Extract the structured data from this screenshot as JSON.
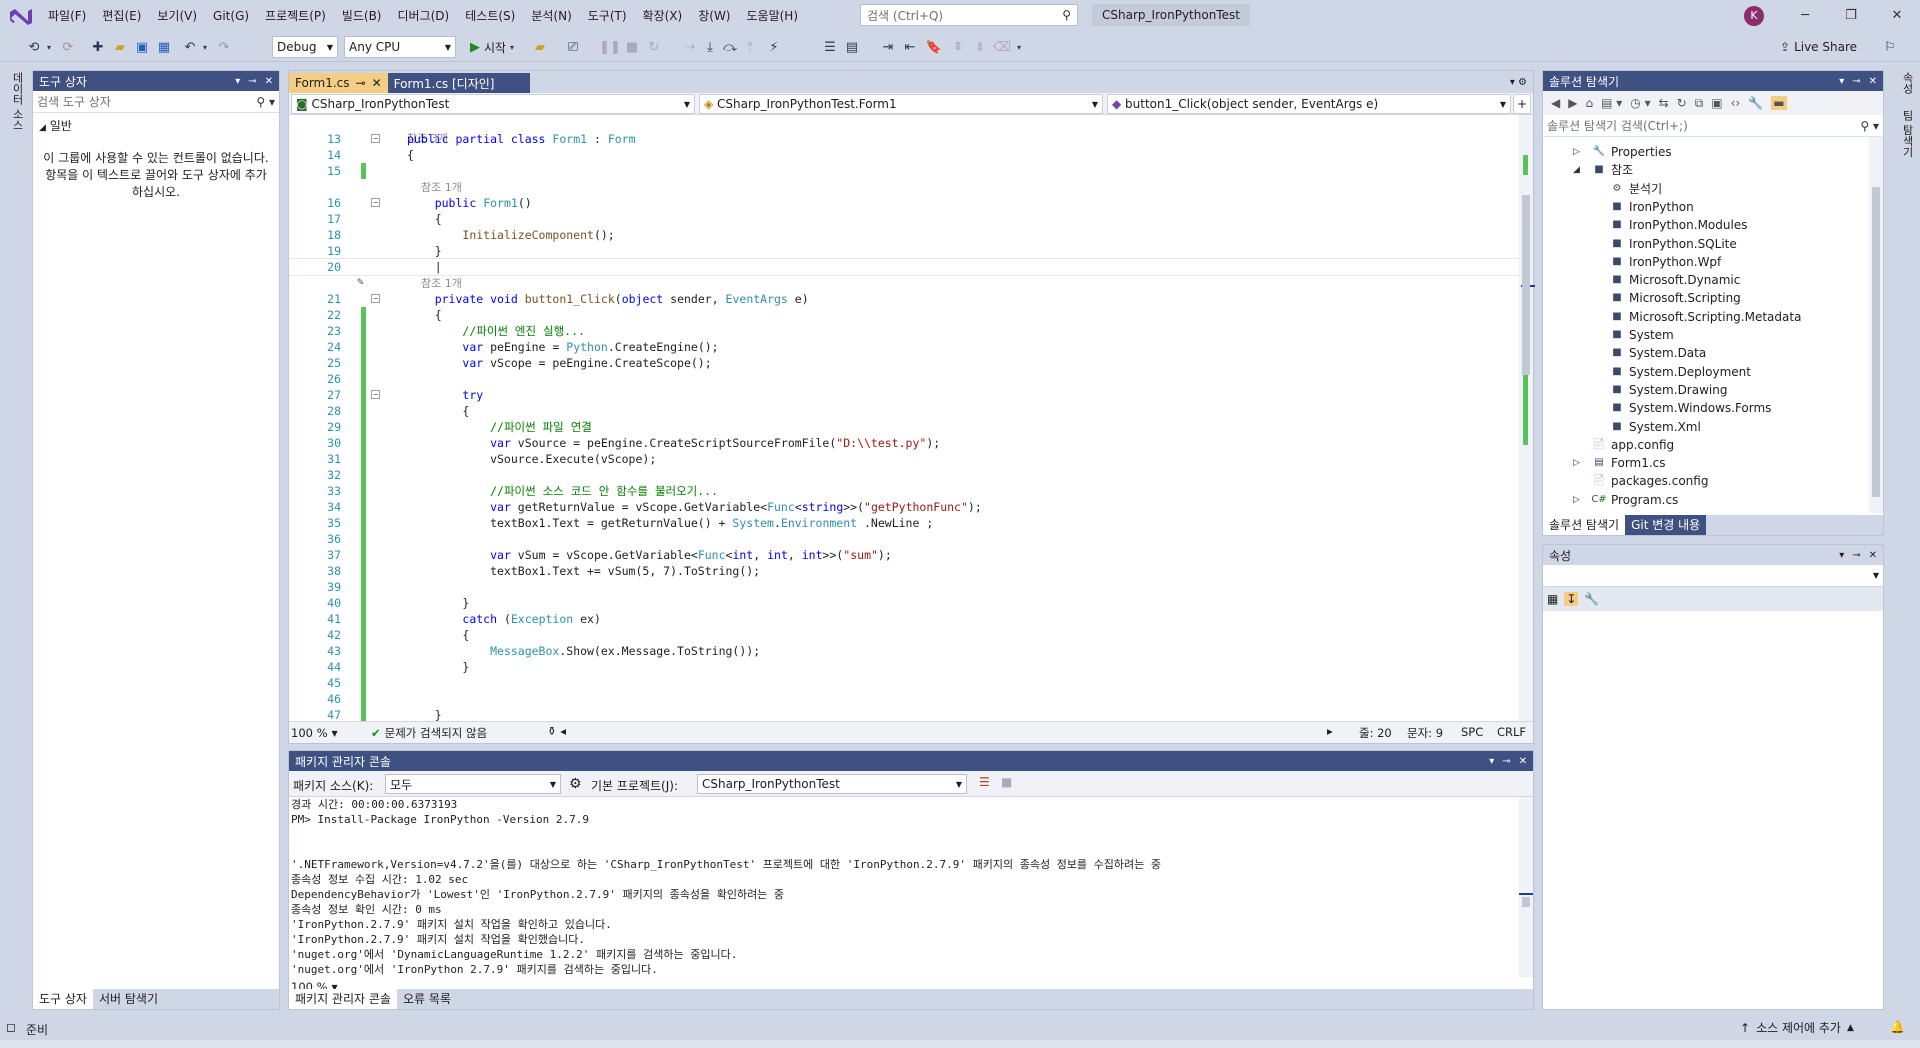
{
  "app": {
    "title": "CSharp_IronPythonTest",
    "search_placeholder": "검색 (Ctrl+Q)",
    "avatar_initial": "K",
    "accent": "#3e5182",
    "active_tab_color": "#f5cc84"
  },
  "menu": [
    "파일(F)",
    "편집(E)",
    "보기(V)",
    "Git(G)",
    "프로젝트(P)",
    "빌드(B)",
    "디버그(D)",
    "테스트(S)",
    "분석(N)",
    "도구(T)",
    "확장(X)",
    "창(W)",
    "도움말(H)"
  ],
  "toolbar": {
    "config": "Debug",
    "platform": "Any CPU",
    "start_label": "시작",
    "live_share": "Live Share"
  },
  "left_strip": {
    "tab": "데이터 소스"
  },
  "right_strip": {
    "tab1": "속성",
    "tab2": "팀 탐색기"
  },
  "toolbox": {
    "title": "도구 상자",
    "search_placeholder": "검색 도구 상자",
    "group": "일반",
    "empty_text": "이 그룹에 사용할 수 있는 컨트롤이 없습니다. 항목을 이 텍스트로 끌어와 도구 상자에 추가하십시오.",
    "tab_toolbox": "도구 상자",
    "tab_server": "서버 탐색기"
  },
  "editor": {
    "tabs": [
      {
        "label": "Form1.cs",
        "pin": "⊸",
        "close": "✕"
      },
      {
        "label": "Form1.cs [디자인]"
      }
    ],
    "nav_project": "CSharp_IronPythonTest",
    "nav_class": "CSharp_IronPythonTest.Form1",
    "nav_member": "button1_Click(object sender, EventArgs e)",
    "lens_top": "참조 3개",
    "lines": [
      {
        "n": "13",
        "html": "<span class=\"kw\">public partial class</span> <span class=\"ty\">Form1</span> : <span class=\"ty\">Form</span>"
      },
      {
        "n": "14",
        "html": "{"
      },
      {
        "n": "15",
        "html": ""
      },
      {
        "n": "",
        "html": "<span class=\"lens\">    참조 1개</span>"
      },
      {
        "n": "16",
        "html": "    <span class=\"kw\">public</span> <span class=\"ty\">Form1</span>()"
      },
      {
        "n": "17",
        "html": "    {"
      },
      {
        "n": "18",
        "html": "        <span style=\"color:#74531f\">InitializeComponent</span>();"
      },
      {
        "n": "19",
        "html": "    }"
      },
      {
        "n": "20",
        "html": "    |"
      },
      {
        "n": "",
        "html": "<span class=\"lens\">    참조 1개</span>"
      },
      {
        "n": "21",
        "html": "    <span class=\"kw\">private void</span> <span style=\"color:#74531f\">button1_Click</span>(<span class=\"kw\">object</span> sender, <span class=\"ty\">EventArgs</span> e)"
      },
      {
        "n": "22",
        "html": "    {"
      },
      {
        "n": "23",
        "html": "        <span class=\"cm\">//파이썬 엔진 실행...</span>"
      },
      {
        "n": "24",
        "html": "        <span class=\"kw\">var</span> peEngine = <span class=\"ty\">Python</span>.CreateEngine();"
      },
      {
        "n": "25",
        "html": "        <span class=\"kw\">var</span> vScope = peEngine.CreateScope();"
      },
      {
        "n": "26",
        "html": ""
      },
      {
        "n": "27",
        "html": "        <span class=\"kw\">try</span>"
      },
      {
        "n": "28",
        "html": "        {"
      },
      {
        "n": "29",
        "html": "            <span class=\"cm\">//파이썬 파일 연결</span>"
      },
      {
        "n": "30",
        "html": "            <span class=\"kw\">var</span> vSource = peEngine.CreateScriptSourceFromFile(<span class=\"st\">\"D:\\\\test.py\"</span>);"
      },
      {
        "n": "31",
        "html": "            vSource.Execute(vScope);"
      },
      {
        "n": "32",
        "html": ""
      },
      {
        "n": "33",
        "html": "            <span class=\"cm\">//파이썬 소스 코드 안 함수를 불러오기...</span>"
      },
      {
        "n": "34",
        "html": "            <span class=\"kw\">var</span> getReturnValue = vScope.GetVariable&lt;<span class=\"ty\">Func</span>&lt;<span class=\"kw\">string</span>&gt;&gt;(<span class=\"st\">\"getPythonFunc\"</span>);"
      },
      {
        "n": "35",
        "html": "            textBox1.Text = getReturnValue() + <span class=\"ty\">System</span>.<span class=\"ty\">Environment</span> .NewLine ;"
      },
      {
        "n": "36",
        "html": ""
      },
      {
        "n": "37",
        "html": "            <span class=\"kw\">var</span> vSum = vScope.GetVariable&lt;<span class=\"ty\">Func</span>&lt;<span class=\"kw\">int</span>, <span class=\"kw\">int</span>, <span class=\"kw\">int</span>&gt;&gt;(<span class=\"st\">\"sum\"</span>);"
      },
      {
        "n": "38",
        "html": "            textBox1.Text += vSum(5, 7).ToString();"
      },
      {
        "n": "39",
        "html": ""
      },
      {
        "n": "40",
        "html": "        }"
      },
      {
        "n": "41",
        "html": "        <span class=\"kw\">catch</span> (<span class=\"ty\">Exception</span> ex)"
      },
      {
        "n": "42",
        "html": "        {"
      },
      {
        "n": "43",
        "html": "            <span class=\"ty\">MessageBox</span>.Show(ex.Message.ToString());"
      },
      {
        "n": "44",
        "html": "        }"
      },
      {
        "n": "45",
        "html": ""
      },
      {
        "n": "46",
        "html": ""
      },
      {
        "n": "47",
        "html": "    }"
      }
    ],
    "zoom": "100 %",
    "issues": "문제가 검색되지 않음",
    "status_line": "줄: 20",
    "status_col": "문자: 9",
    "status_ws": "SPC",
    "status_eol": "CRLF"
  },
  "pmc": {
    "title": "패키지 관리자 콘솔",
    "source_label": "패키지 소스(K):",
    "source_value": "모두",
    "project_label": "기본 프로젝트(J):",
    "project_value": "CSharp_IronPythonTest",
    "output": [
      "경과 시간: 00:00:00.6373193",
      "PM> Install-Package IronPython -Version 2.7.9",
      "",
      "",
      "'.NETFramework,Version=v4.7.2'을(를) 대상으로 하는 'CSharp_IronPythonTest' 프로젝트에 대한 'IronPython.2.7.9' 패키지의 종속성 정보를 수집하려는 중",
      "종속성 정보 수집 시간: 1.02 sec",
      "DependencyBehavior가 'Lowest'인 'IronPython.2.7.9' 패키지의 종속성을 확인하려는 중",
      "종속성 정보 확인 시간: 0 ms",
      "'IronPython.2.7.9' 패키지 설치 작업을 확인하고 있습니다.",
      "'IronPython.2.7.9' 패키지 설치 작업을 확인했습니다.",
      "'nuget.org'에서 'DynamicLanguageRuntime 1.2.2' 패키지를 검색하는 중입니다.",
      "'nuget.org'에서 'IronPython 2.7.9' 패키지를 검색하는 중입니다."
    ],
    "zoom": "100 %",
    "tab_pmc": "패키지 관리자 콘솔",
    "tab_errors": "오류 목록"
  },
  "solution_explorer": {
    "title": "솔루션 탐색기",
    "search_placeholder": "솔루션 탐색기 검색(Ctrl+;)",
    "items": [
      {
        "label": "Properties",
        "icon": "🔧",
        "arrow": "▷",
        "depth": 0
      },
      {
        "label": "참조",
        "icon": "■",
        "arrow": "◢",
        "depth": 0
      },
      {
        "label": "분석기",
        "icon": "⚙",
        "arrow": "",
        "depth": 1
      },
      {
        "label": "IronPython",
        "icon": "■",
        "arrow": "",
        "depth": 1
      },
      {
        "label": "IronPython.Modules",
        "icon": "■",
        "arrow": "",
        "depth": 1
      },
      {
        "label": "IronPython.SQLite",
        "icon": "■",
        "arrow": "",
        "depth": 1
      },
      {
        "label": "IronPython.Wpf",
        "icon": "■",
        "arrow": "",
        "depth": 1
      },
      {
        "label": "Microsoft.Dynamic",
        "icon": "■",
        "arrow": "",
        "depth": 1
      },
      {
        "label": "Microsoft.Scripting",
        "icon": "■",
        "arrow": "",
        "depth": 1
      },
      {
        "label": "Microsoft.Scripting.Metadata",
        "icon": "■",
        "arrow": "",
        "depth": 1
      },
      {
        "label": "System",
        "icon": "■",
        "arrow": "",
        "depth": 1
      },
      {
        "label": "System.Data",
        "icon": "■",
        "arrow": "",
        "depth": 1
      },
      {
        "label": "System.Deployment",
        "icon": "■",
        "arrow": "",
        "depth": 1
      },
      {
        "label": "System.Drawing",
        "icon": "■",
        "arrow": "",
        "depth": 1
      },
      {
        "label": "System.Windows.Forms",
        "icon": "■",
        "arrow": "",
        "depth": 1
      },
      {
        "label": "System.Xml",
        "icon": "■",
        "arrow": "",
        "depth": 1
      },
      {
        "label": "app.config",
        "icon": "📄",
        "arrow": "",
        "depth": 0
      },
      {
        "label": "Form1.cs",
        "icon": "▤",
        "arrow": "▷",
        "depth": 0
      },
      {
        "label": "packages.config",
        "icon": "📄",
        "arrow": "",
        "depth": 0
      },
      {
        "label": "Program.cs",
        "icon": "C#",
        "arrow": "▷",
        "depth": 0
      }
    ],
    "tab_solution": "솔루션 탐색기",
    "tab_git": "Git 변경 내용"
  },
  "properties": {
    "title": "속성"
  },
  "statusbar": {
    "ready": "준비",
    "source_control": "소스 제어에 추가"
  }
}
